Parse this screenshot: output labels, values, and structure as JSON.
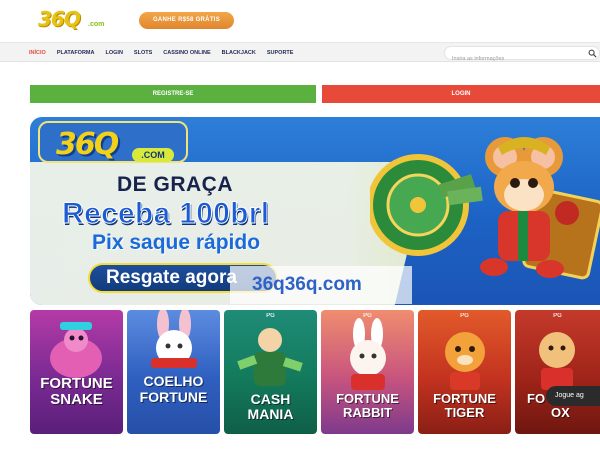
{
  "header": {
    "logo_main": "36Q",
    "logo_suffix": ".com",
    "promo_button": "GANHE R$58 GRÁTIS"
  },
  "nav": {
    "items": [
      "INÍCIO",
      "PLATAFORMA",
      "LOGIN",
      "SLOTS",
      "CASSINO ONLINE",
      "BLACKJACK",
      "SUPORTE"
    ],
    "search_placeholder": "Insira as informações"
  },
  "actions": {
    "register": "REGISTRE-SE",
    "login": "LOGIN"
  },
  "banner": {
    "logo": "36Q",
    "logo_suffix": ".COM",
    "line1": "DE GRAÇA",
    "line2": "Receba 100brl",
    "line3": "Pix saque rápido",
    "cta": "Resgate agora"
  },
  "watermark": "36q36q.com",
  "games": [
    {
      "title_a": "FORTUNE",
      "title_b": "SNAKE"
    },
    {
      "title_a": "COELHO",
      "title_b": "FORTUNE"
    },
    {
      "title_a": "CASH",
      "title_b": "MANIA"
    },
    {
      "title_a": "FORTUNE",
      "title_b": "RABBIT"
    },
    {
      "title_a": "FORTUNE",
      "title_b": "TIGER"
    },
    {
      "title_a": "FO",
      "title_b": "OX"
    }
  ],
  "game_badge": "PG",
  "play_button": "Jogue ag",
  "colors": {
    "accent_green": "#5ab13f",
    "accent_red": "#e84a3a",
    "promo_orange": "#e99a3d",
    "nav_active": "#e14e3e",
    "banner_blue": "#1c62c4"
  }
}
